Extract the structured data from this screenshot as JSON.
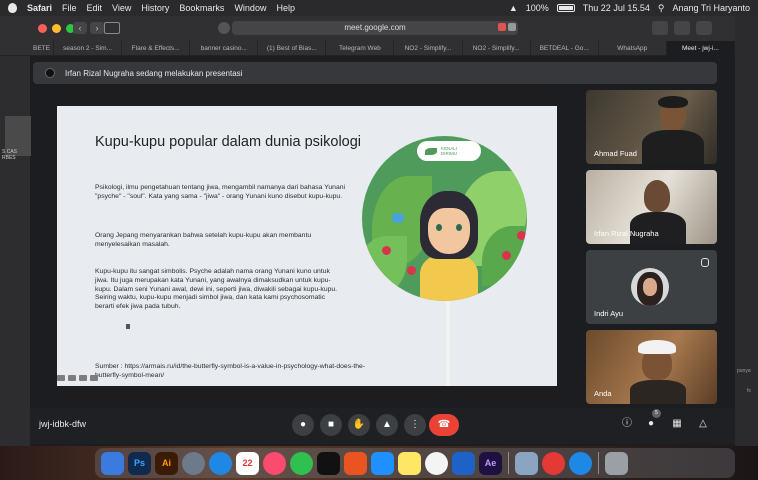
{
  "menubar": {
    "app": "Safari",
    "items": [
      "File",
      "Edit",
      "View",
      "History",
      "Bookmarks",
      "Window",
      "Help"
    ],
    "battery": "100%",
    "datetime": "Thu 22 Jul 15.54",
    "user": "Anang Tri Haryanto"
  },
  "browser": {
    "url": "meet.google.com",
    "tabs": [
      "BETE",
      "season 2 - Sim...",
      "Flare & Effects...",
      "banner casino...",
      "(1) Best of Bias...",
      "Telegram Web",
      "NO2 - Simplify...",
      "NO2 - Simplify...",
      "BETDEAL - Go...",
      "WhatsApp",
      "Meet - jwj-i..."
    ]
  },
  "left_edge": {
    "label": "S CAS RBES"
  },
  "right_edge": {
    "labels": [
      "punya",
      "fx"
    ]
  },
  "meet": {
    "presenting_text": "Irfan Rizal Nugraha sedang melakukan presentasi",
    "meeting_code": "jwj-idbk-dfw",
    "participant_count": "5",
    "participants": [
      {
        "name": "Ahmad Fuad"
      },
      {
        "name": "Irfan Rizal Nugraha"
      },
      {
        "name": "Indri Ayu"
      },
      {
        "name": "Anda"
      }
    ]
  },
  "slide": {
    "title": "Kupu-kupu popular dalam dunia psikologi",
    "paragraphs": [
      "Psikologi, ilmu pengetahuan tentang jiwa, mengambil namanya dari bahasa Yunani \"psyche\" - \"soul\". Kata yang sama - \"jiwa\" - orang Yunani kuno disebut kupu-kupu.",
      "Orang Jepang menyarankan bahwa setelah kupu-kupu akan membantu menyelesaikan masalah.",
      "Kupu-kupu itu sangat simbolis. Psyche adalah nama orang Yunani kuno untuk jiwa. Itu juga merupakan kata Yunani, yang awalnya dimaksudkan untuk kupu-kupu. Dalam seni Yunani awal, dewi ini, seperti jiwa, diwakili sebagai kupu-kupu. Seiring waktu, kupu-kupu menjadi simbol jiwa, dan kata kami psychosomatic berarti efek jiwa pada tubuh."
    ],
    "source": "Sumber : https://armais.ru/id/the-butterfly-symbol-is-a-value-in-psychology-what-does-the-butterfly-symbol-mean/",
    "logo_text": "KENALI\nDIRIMU"
  },
  "colors": {
    "end_call": "#ea4335",
    "meet_bg": "#1f2023",
    "slide_bg": "#e8ecf1",
    "illustration_green": "#4f9b5b"
  }
}
